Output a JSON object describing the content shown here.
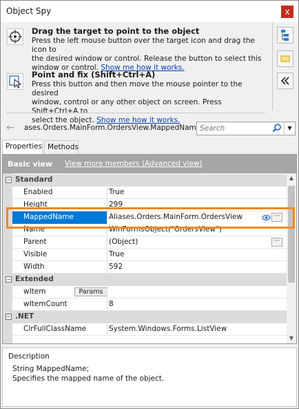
{
  "title_bar": {
    "title": "Object Spy",
    "close_glyph": "x"
  },
  "hints": [
    {
      "title": "Drag the target to point to the object",
      "text_line1": "Press the left mouse button over the target icon and drag the icon to",
      "text_line2": "the desired window or control. Release the button to select this",
      "text_line3_prefix": "window or control. ",
      "link": "Show me how it works.",
      "icon": "crosshair-target-icon"
    },
    {
      "title": "Point and fix (Shift+Ctrl+A)",
      "text_line1": "Press this button and then move the mouse pointer to the desired",
      "text_line2": "window, control or any other object on screen. Press Shift+Ctrl+A to",
      "text_line3_prefix": "select the object. ",
      "link": "Show me how it works.",
      "icon": "pointer-fix-icon"
    }
  ],
  "right_tools": [
    "tree-view-icon",
    "highlight-icon",
    "collapse-panel-icon"
  ],
  "nav": {
    "path": "ases.Orders.MainForm.OrdersView.MappedName",
    "search_placeholder": "Search",
    "back_icon": "back-arrow-icon"
  },
  "tabs": [
    {
      "label": "Properties",
      "active": true
    },
    {
      "label": "Methods",
      "active": false
    }
  ],
  "header": {
    "basic_view": "Basic view",
    "view_more": "View more members (Advanced view)"
  },
  "categories": [
    {
      "name": "Standard",
      "collapse": "−",
      "rows": [
        {
          "name": "Enabled",
          "value": "True"
        },
        {
          "name": "Height",
          "value": "299"
        },
        {
          "name": "MappedName",
          "value": "Aliases.Orders.MainForm.OrdersView",
          "selected": true
        },
        {
          "name": "Name",
          "value": "WinFormsObject(\"OrdersView\")"
        },
        {
          "name": "Parent",
          "value": "(Object)"
        },
        {
          "name": "Visible",
          "value": "True"
        },
        {
          "name": "Width",
          "value": "592"
        }
      ]
    },
    {
      "name": "Extended",
      "collapse": "−",
      "rows": [
        {
          "name": "wItem",
          "value": "",
          "button": "Params"
        },
        {
          "name": "wItemCount",
          "value": "8"
        }
      ]
    },
    {
      "name": ".NET",
      "collapse": "−",
      "rows": [
        {
          "name": "ClrFullClassName",
          "value": "System.Windows.Forms.ListView"
        }
      ]
    }
  ],
  "ellipsis": "···",
  "description": {
    "title": "Description",
    "line1": "String MappedName;",
    "line2": "Specifies the mapped name of the object."
  },
  "colors": {
    "selection": "#0078d7",
    "highlight_border": "#f08a1c",
    "header_bg": "#a6a6a6"
  }
}
